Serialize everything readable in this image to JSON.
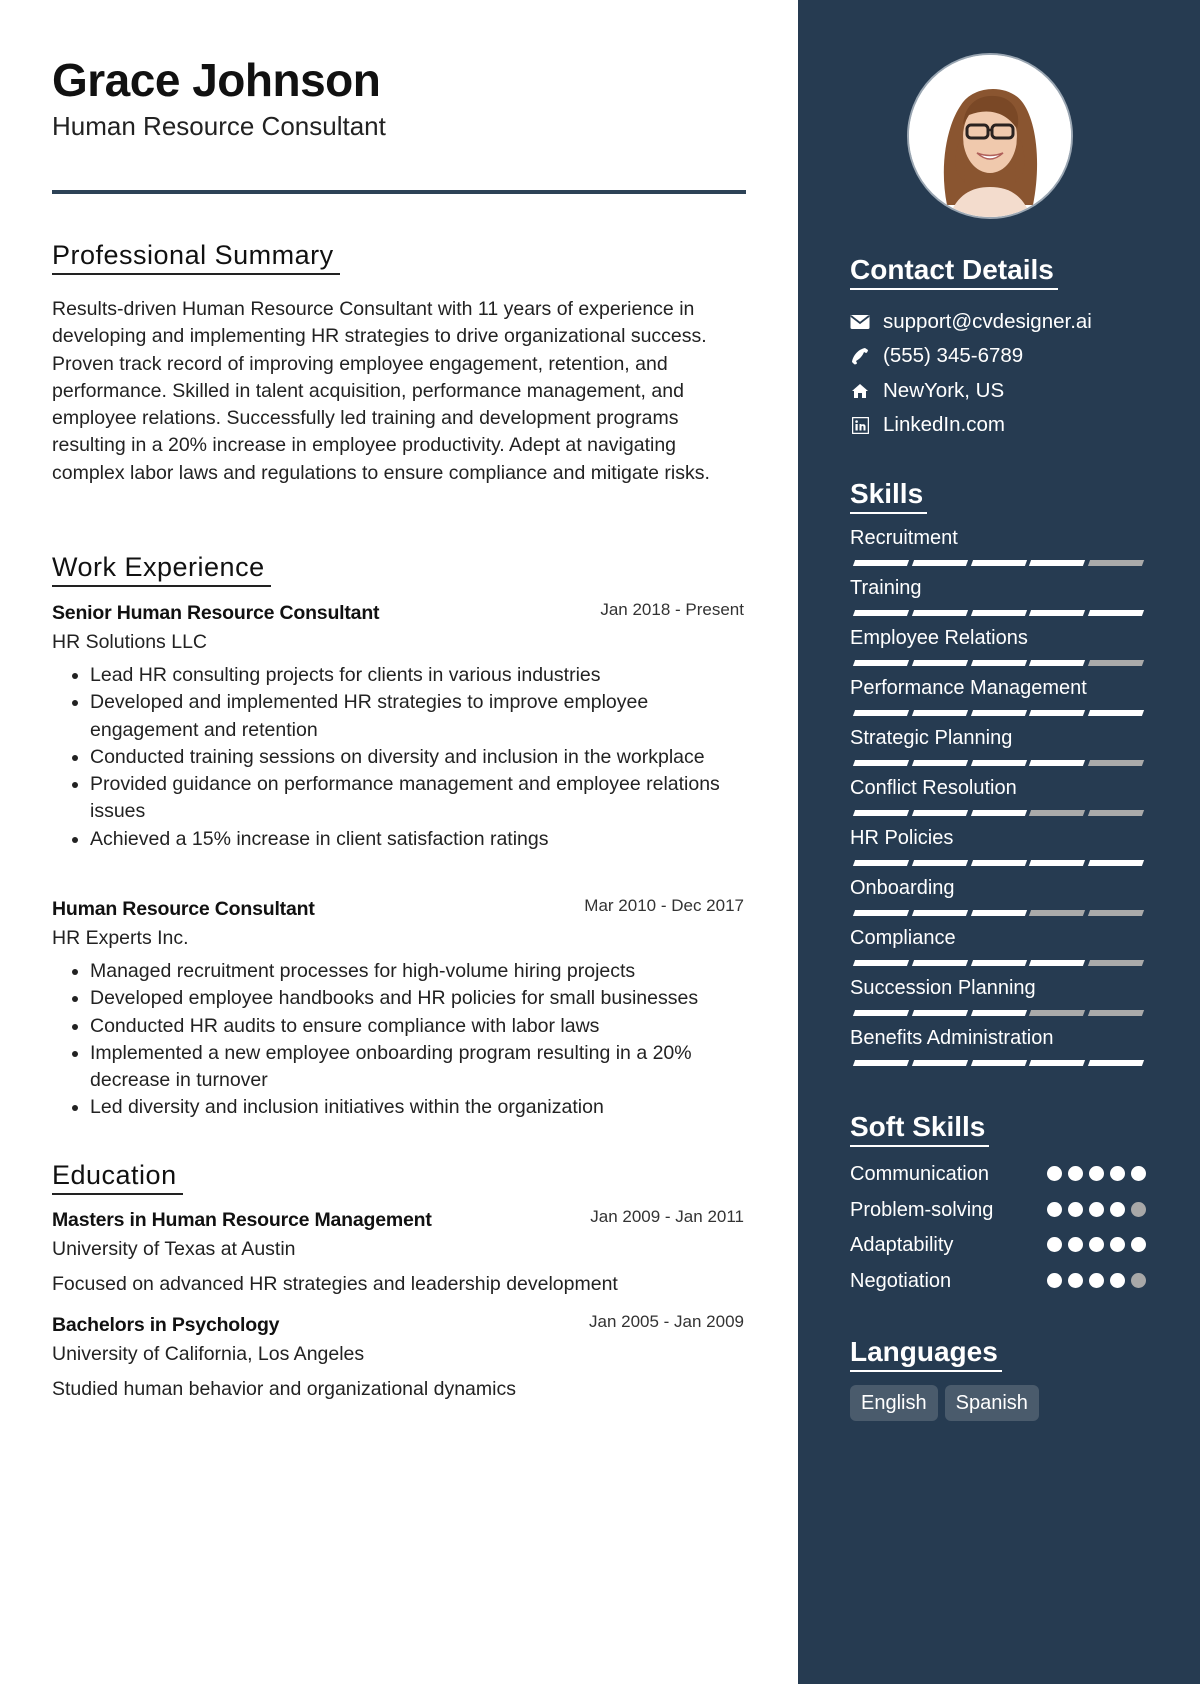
{
  "header": {
    "name": "Grace Johnson",
    "role": "Human Resource Consultant"
  },
  "summary": {
    "title": "Professional Summary",
    "text": "Results-driven Human Resource Consultant with 11 years of experience in developing and implementing HR strategies to drive organizational success. Proven track record of improving employee engagement, retention, and performance. Skilled in talent acquisition, performance management, and employee relations. Successfully led training and development programs resulting in a 20% increase in employee productivity. Adept at navigating complex labor laws and regulations to ensure compliance and mitigate risks."
  },
  "experience": {
    "title": "Work Experience",
    "jobs": [
      {
        "title": "Senior Human Resource Consultant",
        "date": "Jan 2018 - Present",
        "company": "HR Solutions LLC",
        "bullets": [
          "Lead HR consulting projects for clients in various industries",
          "Developed and implemented HR strategies to improve employee engagement and retention",
          "Conducted training sessions on diversity and inclusion in the workplace",
          "Provided guidance on performance management and employee relations issues",
          "Achieved a 15% increase in client satisfaction ratings"
        ]
      },
      {
        "title": "Human Resource Consultant",
        "date": "Mar 2010 - Dec 2017",
        "company": "HR Experts Inc.",
        "bullets": [
          "Managed recruitment processes for high-volume hiring projects",
          "Developed employee handbooks and HR policies for small businesses",
          "Conducted HR audits to ensure compliance with labor laws",
          "Implemented a new employee onboarding program resulting in a 20% decrease in turnover",
          "Led diversity and inclusion initiatives within the organization"
        ]
      }
    ]
  },
  "education": {
    "title": "Education",
    "items": [
      {
        "degree": "Masters in Human Resource Management",
        "date": "Jan 2009 - Jan 2011",
        "school": "University of Texas at Austin",
        "description": "Focused on advanced HR strategies and leadership development"
      },
      {
        "degree": "Bachelors in Psychology",
        "date": "Jan 2005 - Jan 2009",
        "school": "University of California, Los Angeles",
        "description": "Studied human behavior and organizational dynamics"
      }
    ]
  },
  "sidebar": {
    "photo_alt": "Profile photo of Grace Johnson",
    "contact": {
      "title": "Contact Details",
      "items": [
        {
          "icon": "envelope-icon",
          "text": "support@cvdesigner.ai"
        },
        {
          "icon": "phone-icon",
          "text": "(555) 345-6789"
        },
        {
          "icon": "home-icon",
          "text": "NewYork, US"
        },
        {
          "icon": "linkedin-icon",
          "text": "LinkedIn.com"
        }
      ]
    },
    "skills": {
      "title": "Skills",
      "max": 5,
      "items": [
        {
          "name": "Recruitment",
          "level": 4
        },
        {
          "name": "Training",
          "level": 5
        },
        {
          "name": "Employee Relations",
          "level": 4
        },
        {
          "name": "Performance Management",
          "level": 5
        },
        {
          "name": "Strategic Planning",
          "level": 4
        },
        {
          "name": "Conflict Resolution",
          "level": 3
        },
        {
          "name": "HR Policies",
          "level": 5
        },
        {
          "name": "Onboarding",
          "level": 3
        },
        {
          "name": "Compliance",
          "level": 4
        },
        {
          "name": "Succession Planning",
          "level": 3
        },
        {
          "name": "Benefits Administration",
          "level": 5
        }
      ]
    },
    "soft_skills": {
      "title": "Soft Skills",
      "max": 5,
      "items": [
        {
          "name": "Communication",
          "level": 5
        },
        {
          "name": "Problem-solving",
          "level": 4
        },
        {
          "name": "Adaptability",
          "level": 5
        },
        {
          "name": "Negotiation",
          "level": 4
        }
      ]
    },
    "languages": {
      "title": "Languages",
      "items": [
        "English",
        "Spanish"
      ]
    }
  },
  "colors": {
    "sidebar_bg": "#263b51",
    "accent_line": "#2d4256",
    "filled": "#ffffff",
    "unfilled": "#aaaaaa",
    "chip_bg": "#4a5b6c"
  }
}
